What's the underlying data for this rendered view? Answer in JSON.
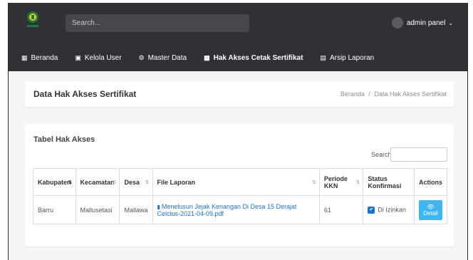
{
  "header": {
    "search_placeholder": "Search...",
    "user_name": "admin panel"
  },
  "nav": [
    {
      "label": "Beranda",
      "icon": "home-icon"
    },
    {
      "label": "Kelola User",
      "icon": "user-icon"
    },
    {
      "label": "Master Data",
      "icon": "settings-icon"
    },
    {
      "label": "Hak Akses Cetak Sertifikat",
      "icon": "grid-icon"
    },
    {
      "label": "Arsip Laporan",
      "icon": "archive-icon"
    }
  ],
  "page": {
    "title": "Data Hak Akses Sertifikat",
    "breadcrumb_home": "Beranda",
    "breadcrumb_sep": "/",
    "breadcrumb_current": "Data Hak Akses Sertifikat"
  },
  "table_card": {
    "heading": "Tabel Hak Akses",
    "search_label": "Search:",
    "columns": [
      "Kabupaten",
      "Kecamatan",
      "Desa",
      "File Laporan",
      "Periode KKN",
      "Status Konfirmasi",
      "Actions"
    ],
    "rows": [
      {
        "kabupaten": "Barru",
        "kecamatan": "Mallusetasi",
        "desa": "Mallawa",
        "file": "Menelusuri Jejak Kenangan Di Desa 15 Derajat Celcius-2021-04-09.pdf",
        "periode": "61",
        "status": "Di Izinkan",
        "action": "Detail"
      }
    ]
  },
  "colors": {
    "topbar": "#2f3136",
    "link": "#1a73c8",
    "detail_button": "#3fb6f0"
  }
}
